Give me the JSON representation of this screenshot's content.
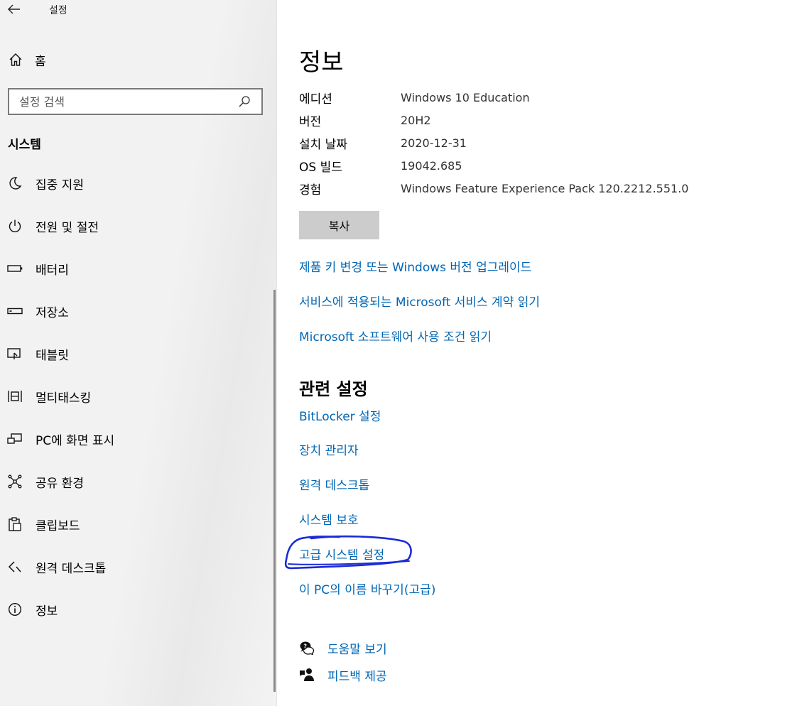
{
  "app": {
    "title": "설정"
  },
  "sidebar": {
    "home_label": "홈",
    "search_placeholder": "설정 검색",
    "section_title": "시스템",
    "items": [
      {
        "label": "집중 지원",
        "icon": "moon-icon"
      },
      {
        "label": "전원 및 절전",
        "icon": "power-icon"
      },
      {
        "label": "배터리",
        "icon": "battery-icon"
      },
      {
        "label": "저장소",
        "icon": "storage-icon"
      },
      {
        "label": "태블릿",
        "icon": "tablet-icon"
      },
      {
        "label": "멀티태스킹",
        "icon": "multitasking-icon"
      },
      {
        "label": "PC에 화면 표시",
        "icon": "projecting-icon"
      },
      {
        "label": "공유 환경",
        "icon": "share-icon"
      },
      {
        "label": "클립보드",
        "icon": "clipboard-icon"
      },
      {
        "label": "원격 데스크톱",
        "icon": "remote-desktop-icon"
      },
      {
        "label": "정보",
        "icon": "info-icon"
      }
    ]
  },
  "main": {
    "title": "정보",
    "specs": [
      {
        "key": "에디션",
        "value": "Windows 10 Education"
      },
      {
        "key": "버전",
        "value": "20H2"
      },
      {
        "key": "설치 날짜",
        "value": "2020-12-31"
      },
      {
        "key": "OS 빌드",
        "value": "19042.685"
      },
      {
        "key": "경험",
        "value": "Windows Feature Experience Pack 120.2212.551.0"
      }
    ],
    "copy_label": "복사",
    "links": [
      "제품 키 변경 또는 Windows 버전 업그레이드",
      "서비스에 적용되는 Microsoft 서비스 계약 읽기",
      "Microsoft 소프트웨어 사용 조건 읽기"
    ],
    "related_title": "관련 설정",
    "related_links": [
      "BitLocker 설정",
      "장치 관리자",
      "원격 데스크톱",
      "시스템 보호",
      "고급 시스템 설정",
      "이 PC의 이름 바꾸기(고급)"
    ],
    "help": [
      {
        "label": "도움말 보기",
        "icon": "help-chat-icon"
      },
      {
        "label": "피드백 제공",
        "icon": "feedback-icon"
      }
    ]
  },
  "colors": {
    "link": "#0066b4",
    "annotation": "#1a2bd6",
    "button": "#cccccc"
  }
}
